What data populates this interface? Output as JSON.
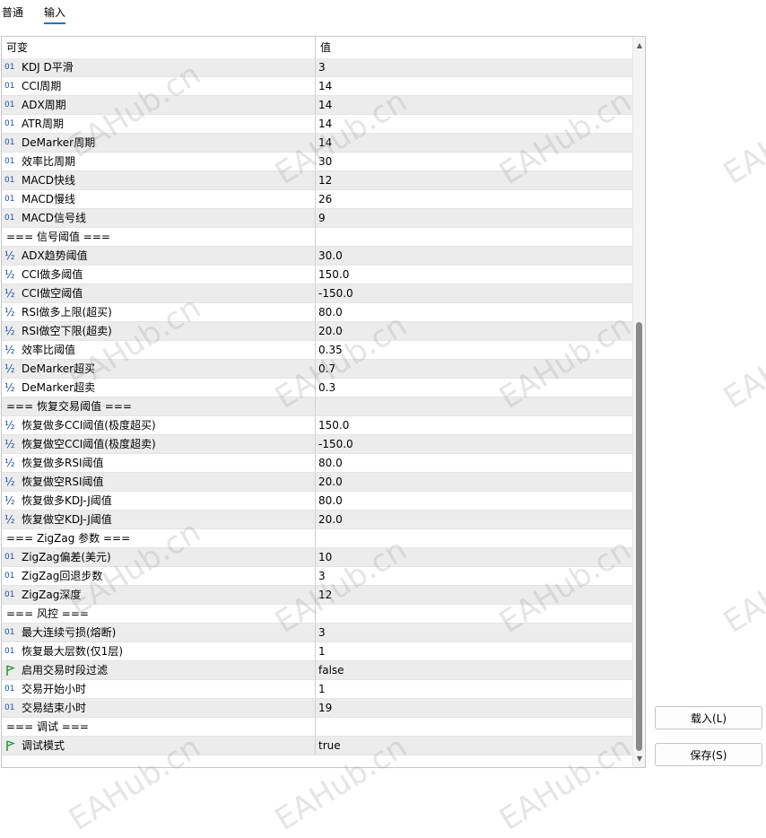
{
  "tabs": [
    {
      "label": "普通",
      "active": false
    },
    {
      "label": "输入",
      "active": true
    }
  ],
  "grid": {
    "header": {
      "name": "可变",
      "value": "值"
    },
    "rows": [
      {
        "icon": "01",
        "name": "KDJ D平滑",
        "value": "3",
        "kind": "int"
      },
      {
        "icon": "01",
        "name": "CCI周期",
        "value": "14",
        "kind": "int"
      },
      {
        "icon": "01",
        "name": "ADX周期",
        "value": "14",
        "kind": "int"
      },
      {
        "icon": "01",
        "name": "ATR周期",
        "value": "14",
        "kind": "int"
      },
      {
        "icon": "01",
        "name": "DeMarker周期",
        "value": "14",
        "kind": "int"
      },
      {
        "icon": "01",
        "name": "效率比周期",
        "value": "30",
        "kind": "int"
      },
      {
        "icon": "01",
        "name": "MACD快线",
        "value": "12",
        "kind": "int"
      },
      {
        "icon": "01",
        "name": "MACD慢线",
        "value": "26",
        "kind": "int"
      },
      {
        "icon": "01",
        "name": "MACD信号线",
        "value": "9",
        "kind": "int"
      },
      {
        "icon": "",
        "name": "=== 信号阈值 ===",
        "value": "",
        "kind": "section"
      },
      {
        "icon": "½",
        "name": "ADX趋势阈值",
        "value": "30.0",
        "kind": "double"
      },
      {
        "icon": "½",
        "name": "CCI做多阈值",
        "value": "150.0",
        "kind": "double"
      },
      {
        "icon": "½",
        "name": "CCI做空阈值",
        "value": "-150.0",
        "kind": "double"
      },
      {
        "icon": "½",
        "name": "RSI做多上限(超买)",
        "value": "80.0",
        "kind": "double"
      },
      {
        "icon": "½",
        "name": "RSI做空下限(超卖)",
        "value": "20.0",
        "kind": "double"
      },
      {
        "icon": "½",
        "name": "效率比阈值",
        "value": "0.35",
        "kind": "double"
      },
      {
        "icon": "½",
        "name": "DeMarker超买",
        "value": "0.7",
        "kind": "double"
      },
      {
        "icon": "½",
        "name": "DeMarker超卖",
        "value": "0.3",
        "kind": "double"
      },
      {
        "icon": "",
        "name": "=== 恢复交易阈值 ===",
        "value": "",
        "kind": "section"
      },
      {
        "icon": "½",
        "name": "恢复做多CCI阈值(极度超买)",
        "value": "150.0",
        "kind": "double"
      },
      {
        "icon": "½",
        "name": "恢复做空CCI阈值(极度超卖)",
        "value": "-150.0",
        "kind": "double"
      },
      {
        "icon": "½",
        "name": "恢复做多RSI阈值",
        "value": "80.0",
        "kind": "double"
      },
      {
        "icon": "½",
        "name": "恢复做空RSI阈值",
        "value": "20.0",
        "kind": "double"
      },
      {
        "icon": "½",
        "name": "恢复做多KDJ-J阈值",
        "value": "80.0",
        "kind": "double"
      },
      {
        "icon": "½",
        "name": "恢复做空KDJ-J阈值",
        "value": "20.0",
        "kind": "double"
      },
      {
        "icon": "",
        "name": "=== ZigZag 参数 ===",
        "value": "",
        "kind": "section"
      },
      {
        "icon": "01",
        "name": "ZigZag偏差(美元)",
        "value": "10",
        "kind": "int"
      },
      {
        "icon": "01",
        "name": "ZigZag回退步数",
        "value": "3",
        "kind": "int"
      },
      {
        "icon": "01",
        "name": "ZigZag深度",
        "value": "12",
        "kind": "int"
      },
      {
        "icon": "",
        "name": "=== 风控 ===",
        "value": "",
        "kind": "section"
      },
      {
        "icon": "01",
        "name": "最大连续亏损(熔断)",
        "value": "3",
        "kind": "int"
      },
      {
        "icon": "01",
        "name": "恢复最大层数(仅1层)",
        "value": "1",
        "kind": "int"
      },
      {
        "icon": "flag",
        "name": "启用交易时段过滤",
        "value": "false",
        "kind": "bool"
      },
      {
        "icon": "01",
        "name": "交易开始小时",
        "value": "1",
        "kind": "int"
      },
      {
        "icon": "01",
        "name": "交易结束小时",
        "value": "19",
        "kind": "int"
      },
      {
        "icon": "",
        "name": "=== 调试 ===",
        "value": "",
        "kind": "section"
      },
      {
        "icon": "flag",
        "name": "调试模式",
        "value": "true",
        "kind": "bool"
      }
    ]
  },
  "buttons": {
    "load": "载入(L)",
    "save": "保存(S)"
  },
  "watermark": "EAHub.cn",
  "colors": {
    "accent": "#2b6fc7",
    "icon_blue": "#1f4fa6",
    "flag_green": "#2e9a3c",
    "row_alt": "#ececec"
  }
}
